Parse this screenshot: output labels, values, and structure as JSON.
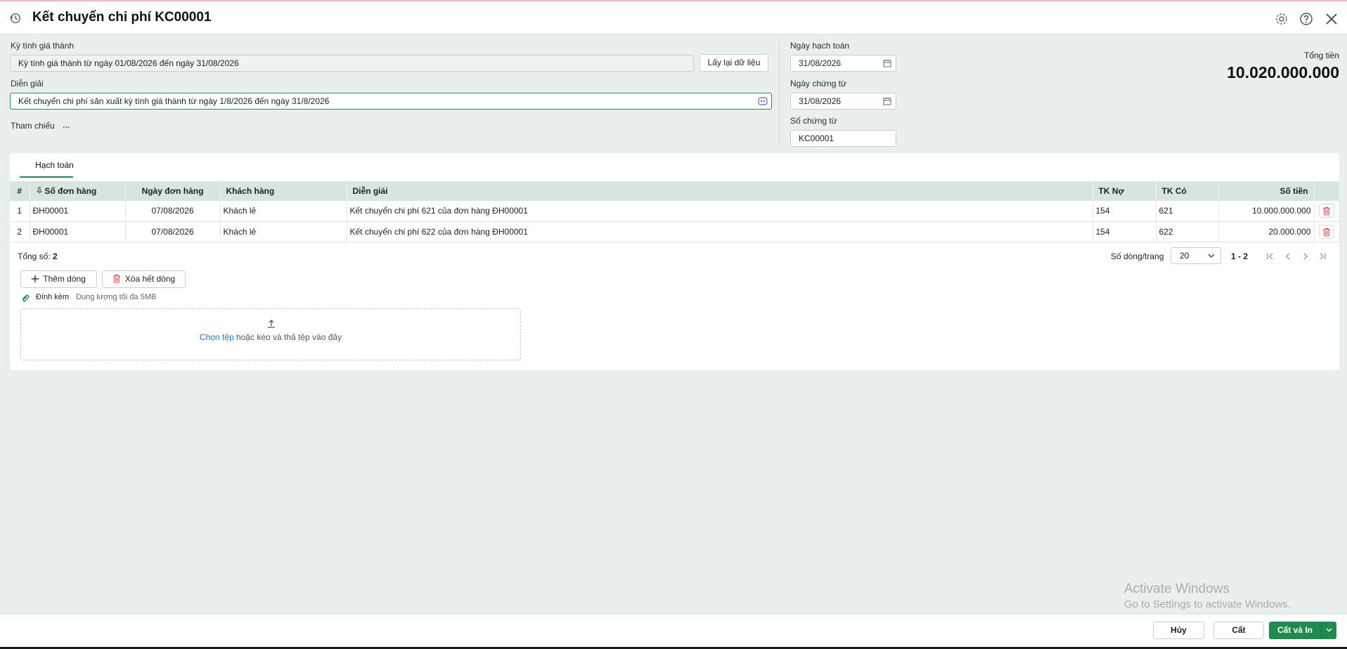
{
  "header": {
    "title": "Kết chuyển chi phí KC00001"
  },
  "form": {
    "ky_label": "Kỳ tính giá thành",
    "ky_value": "Kỳ tính giá thành từ ngày 01/08/2026 đến ngày 31/08/2026",
    "reload_button": "Lấy lại dữ liệu",
    "dien_giai_label": "Diễn giải",
    "dien_giai_value": "Kết chuyển chi phí sản xuất kỳ tính giá thành từ ngày 1/8/2026 đến ngày 31/8/2026",
    "tham_chieu_label": "Tham chiếu",
    "tham_chieu_link": "...",
    "ngay_hach_toan_label": "Ngày hạch toán",
    "ngay_hach_toan_value": "31/08/2026",
    "ngay_chung_tu_label": "Ngày chứng từ",
    "ngay_chung_tu_value": "31/08/2026",
    "so_chung_tu_label": "Số chứng từ",
    "so_chung_tu_value": "KC00001",
    "tong_tien_label": "Tổng tiền",
    "tong_tien_value": "10.020.000.000"
  },
  "tabs": [
    {
      "label": "Hạch toán"
    }
  ],
  "table": {
    "headers": [
      "#",
      "Số đơn hàng",
      "Ngày đơn hàng",
      "Khách hàng",
      "Diễn giải",
      "TK Nợ",
      "TK Có",
      "Số tiền"
    ],
    "rows": [
      {
        "no": "1",
        "so_don_hang": "ĐH00001",
        "ngay": "07/08/2026",
        "khach_hang": "Khách lẻ",
        "dien_giai": "Kết chuyển chi phí 621 của đơn hàng ĐH00001",
        "tk_no": "154",
        "tk_co": "621",
        "so_tien": "10.000.000.000"
      },
      {
        "no": "2",
        "so_don_hang": "ĐH00001",
        "ngay": "07/08/2026",
        "khach_hang": "Khách lẻ",
        "dien_giai": "Kết chuyển chi phí 622 của đơn hàng ĐH00001",
        "tk_no": "154",
        "tk_co": "622",
        "so_tien": "20.000.000"
      }
    ]
  },
  "footer": {
    "tong_so_label": "Tổng số:",
    "tong_so_value": "2",
    "rows_per_page_label": "Số dòng/trang",
    "rows_per_page_value": "20",
    "page_range": "1 - 2",
    "add_row": "Thêm dòng",
    "delete_all": "Xóa hết dòng"
  },
  "attachment": {
    "label": "Đính kèm",
    "hint": "Dung lượng tối đa 5MB",
    "choose": "Chọn tệp",
    "drop_text": " hoặc kéo và thả tệp vào đây"
  },
  "watermark": {
    "line1": "Activate Windows",
    "line2": "Go to Settings to activate Windows."
  },
  "actions": {
    "cancel": "Hủy",
    "save": "Cất",
    "save_print": "Cất và In"
  },
  "colors": {
    "accent": "#1f8c4e",
    "header_row": "#d7e6df",
    "danger": "#e0474c",
    "background": "#e8efec"
  }
}
